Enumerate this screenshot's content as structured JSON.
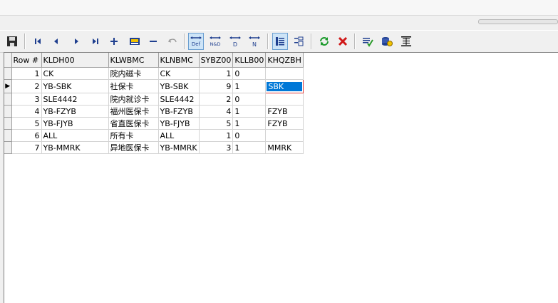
{
  "toolbar": {
    "buttons": [
      {
        "name": "save-icon"
      },
      {
        "name": "first-record-icon"
      },
      {
        "name": "prior-record-icon"
      },
      {
        "name": "next-record-icon"
      },
      {
        "name": "last-record-icon"
      },
      {
        "name": "insert-record-icon"
      },
      {
        "name": "edit-record-icon"
      },
      {
        "name": "delete-record-icon"
      },
      {
        "name": "undo-icon"
      },
      {
        "name": "default-mode-icon",
        "label": "Def"
      },
      {
        "name": "n-and-d-mode-icon",
        "label": "N&D"
      },
      {
        "name": "d-mode-icon",
        "label": "D"
      },
      {
        "name": "n-mode-icon",
        "label": "N"
      },
      {
        "name": "grid-view-icon"
      },
      {
        "name": "form-view-icon"
      },
      {
        "name": "refresh-icon"
      },
      {
        "name": "cancel-icon"
      },
      {
        "name": "check-list-icon"
      },
      {
        "name": "database-icon"
      },
      {
        "name": "fit-columns-icon"
      }
    ]
  },
  "grid": {
    "columns": [
      "Row #",
      "KLDH00",
      "KLWBMC",
      "KLNBMC",
      "SYBZ00",
      "KLLB00",
      "KHQZBH"
    ],
    "current_row_indicator": "▶",
    "rows": [
      {
        "row": "1",
        "kldh00": "CK",
        "klwbmc": "院内磁卡",
        "klnbmc": "CK",
        "sybz00": "1",
        "kllb00": "0",
        "khqzbh": ""
      },
      {
        "row": "2",
        "kldh00": "YB-SBK",
        "klwbmc": "社保卡",
        "klnbmc": "YB-SBK",
        "sybz00": "9",
        "kllb00": "1",
        "khqzbh": "SBK"
      },
      {
        "row": "3",
        "kldh00": "SLE4442",
        "klwbmc": "院内就诊卡",
        "klnbmc": "SLE4442",
        "sybz00": "2",
        "kllb00": "0",
        "khqzbh": ""
      },
      {
        "row": "4",
        "kldh00": "YB-FZYB",
        "klwbmc": "福州医保卡",
        "klnbmc": "YB-FZYB",
        "sybz00": "4",
        "kllb00": "1",
        "khqzbh": "FZYB"
      },
      {
        "row": "5",
        "kldh00": "YB-FJYB",
        "klwbmc": "省直医保卡",
        "klnbmc": "YB-FJYB",
        "sybz00": "5",
        "kllb00": "1",
        "khqzbh": "FZYB"
      },
      {
        "row": "6",
        "kldh00": "ALL",
        "klwbmc": "所有卡",
        "klnbmc": "ALL",
        "sybz00": "1",
        "kllb00": "0",
        "khqzbh": ""
      },
      {
        "row": "7",
        "kldh00": "YB-MMRK",
        "klwbmc": "异地医保卡",
        "klnbmc": "YB-MMRK",
        "sybz00": "3",
        "kllb00": "1",
        "khqzbh": "MMRK"
      }
    ]
  },
  "colors": {
    "selection": "#0078d7",
    "focus_border": "#e04040",
    "refresh_green": "#1a9a2a",
    "cancel_red": "#d01818"
  }
}
